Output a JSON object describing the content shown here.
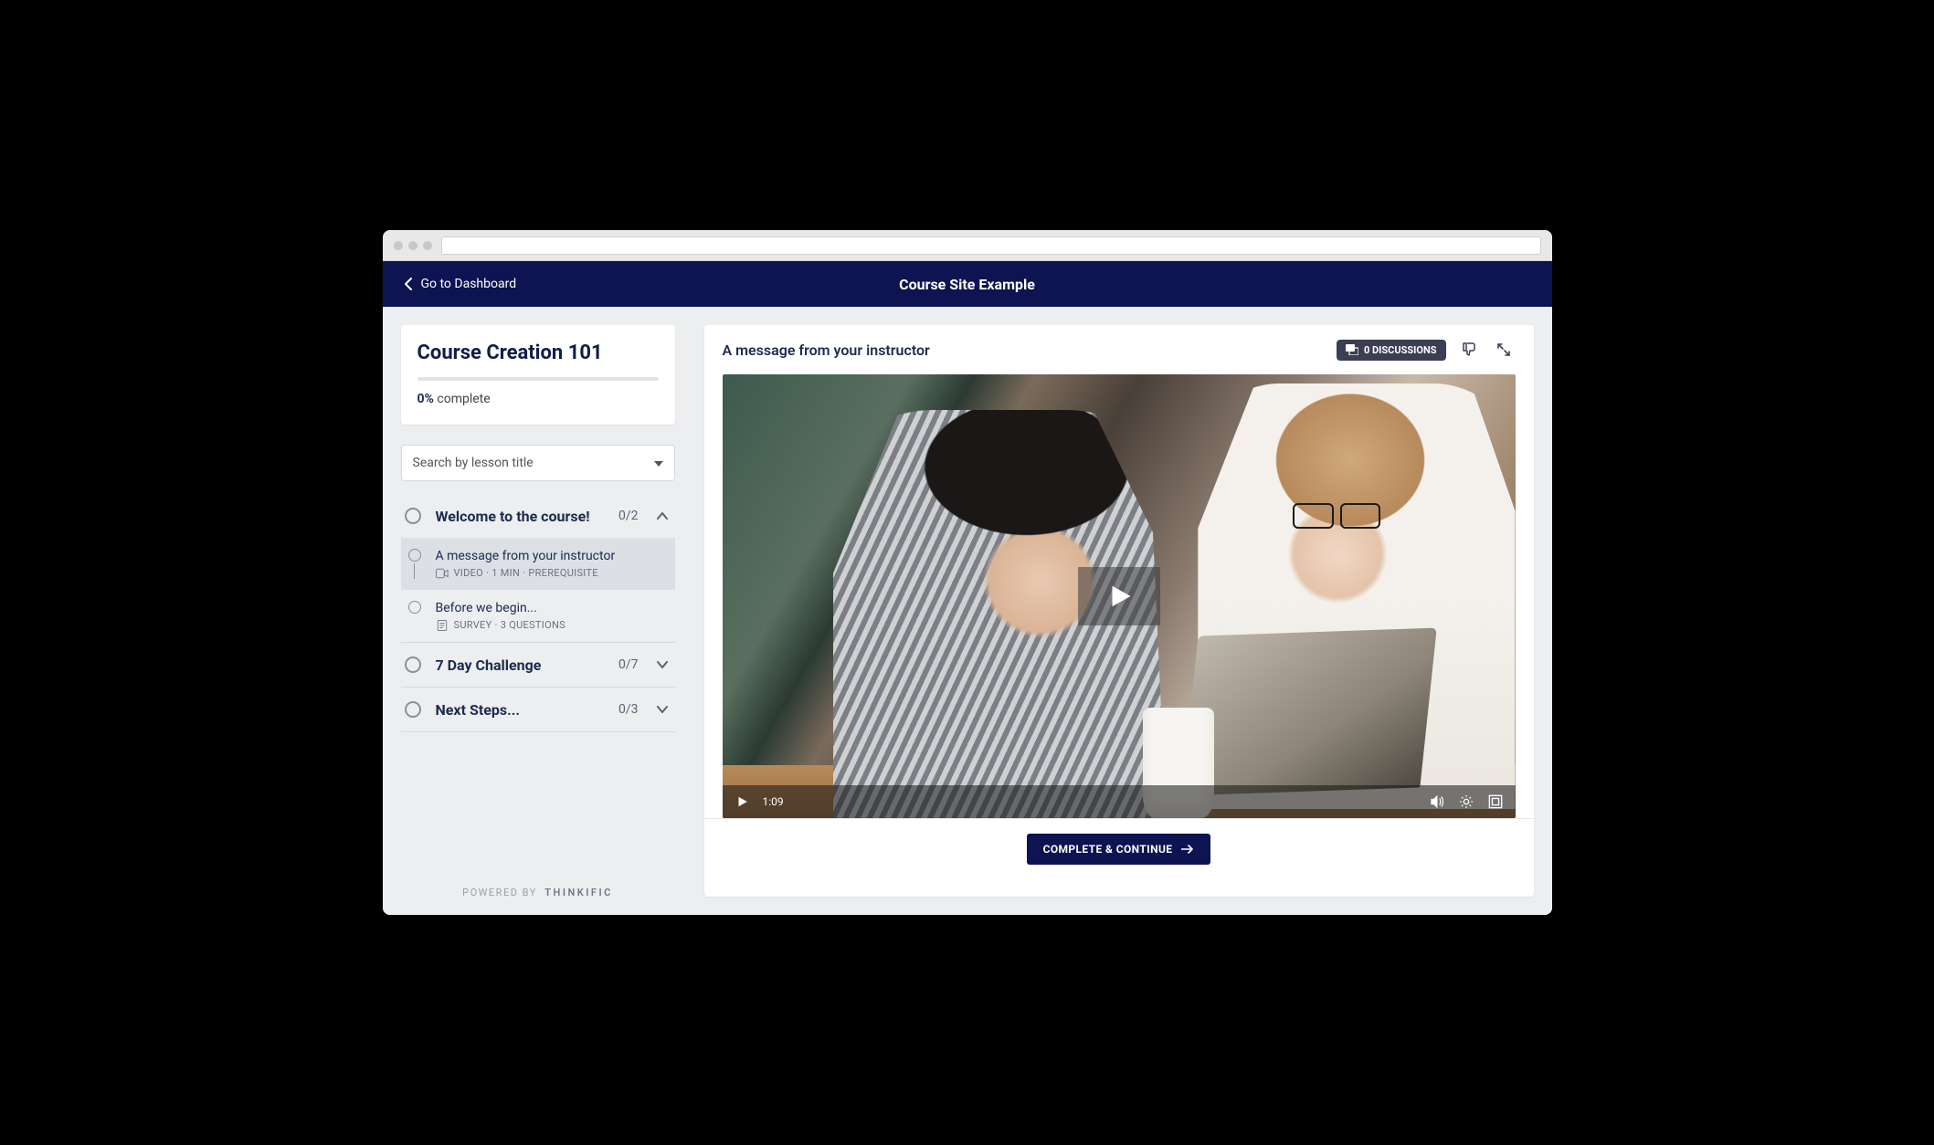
{
  "header": {
    "back_label": "Go to Dashboard",
    "site_title": "Course Site Example"
  },
  "course": {
    "title": "Course Creation 101",
    "progress_pct": "0%",
    "progress_word": "complete"
  },
  "search": {
    "placeholder": "Search by lesson title"
  },
  "chapters": [
    {
      "title": "Welcome to the course!",
      "count": "0/2",
      "expanded": true,
      "lessons": [
        {
          "title": "A message from your instructor",
          "meta": "VIDEO · 1 MIN  ·  PREREQUISITE",
          "icon": "video",
          "active": true
        },
        {
          "title": "Before we begin...",
          "meta": "SURVEY · 3 QUESTIONS",
          "icon": "survey",
          "active": false
        }
      ]
    },
    {
      "title": "7 Day Challenge",
      "count": "0/7",
      "expanded": false,
      "lessons": []
    },
    {
      "title": "Next Steps...",
      "count": "0/3",
      "expanded": false,
      "lessons": []
    }
  ],
  "powered": {
    "prefix": "POWERED BY",
    "brand": "THINKIFIC"
  },
  "main": {
    "lesson_title": "A message from your instructor",
    "discussions_label": "0 DISCUSSIONS",
    "video_time": "1:09",
    "complete_label": "COMPLETE & CONTINUE"
  }
}
